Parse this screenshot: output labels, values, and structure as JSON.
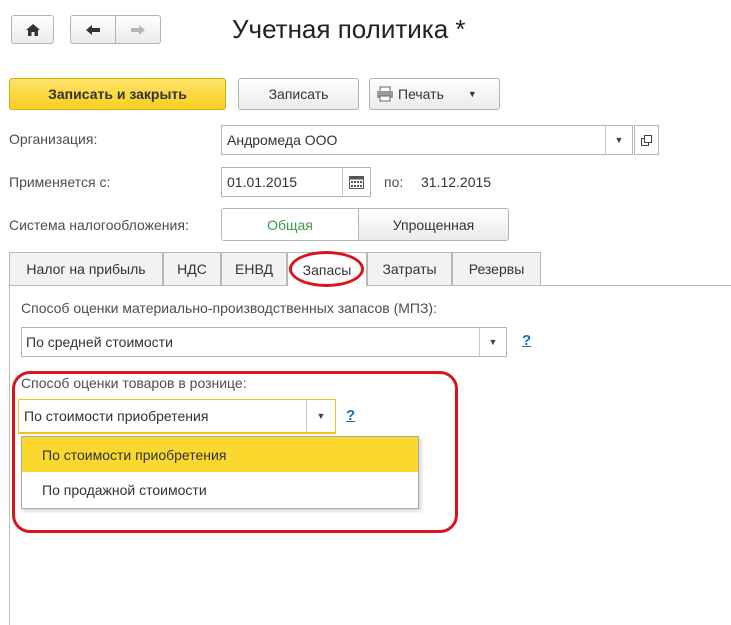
{
  "header": {
    "title": "Учетная политика *"
  },
  "toolbar": {
    "save_close_label": "Записать и закрыть",
    "save_label": "Записать",
    "print_label": "Печать"
  },
  "organization": {
    "label": "Организация:",
    "value": "Андромеда ООО"
  },
  "period": {
    "label": "Применяется с:",
    "from_value": "01.01.2015",
    "to_label": "по:",
    "to_value": "31.12.2015"
  },
  "tax_system": {
    "label": "Система налогообложения:",
    "options": [
      "Общая",
      "Упрощенная"
    ],
    "selected": "Общая"
  },
  "tabs": [
    "Налог на прибыль",
    "НДС",
    "ЕНВД",
    "Запасы",
    "Затраты",
    "Резервы"
  ],
  "active_tab": "Запасы",
  "inventory": {
    "mpz_label": "Способ оценки материально-производственных запасов (МПЗ):",
    "mpz_value": "По средней стоимости",
    "retail_label": "Способ оценки товаров в рознице:",
    "retail_value": "По стоимости приобретения",
    "retail_options": [
      "По стоимости приобретения",
      "По продажной стоимости"
    ],
    "help": "?"
  },
  "colors": {
    "accent_yellow": "#fdd835",
    "highlight_red": "#d9141b",
    "link_blue": "#1c6eb5",
    "green_text": "#3a9a4a"
  }
}
